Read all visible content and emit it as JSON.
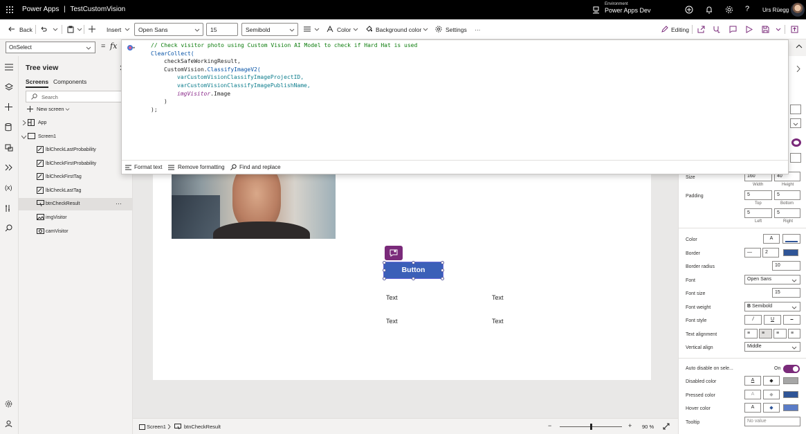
{
  "app": {
    "name": "Power Apps",
    "separator": "|",
    "project": "TestCustomVision"
  },
  "environment": {
    "label": "Environment",
    "name": "Power Apps Dev"
  },
  "user": {
    "name": "Urs Rüegg"
  },
  "toolbar": {
    "back": "Back",
    "insert": "Insert",
    "font": "Open Sans",
    "font_size": "15",
    "font_weight": "Semibold",
    "color": "Color",
    "background_color": "Background color",
    "settings": "Settings",
    "more": "···",
    "editing": "Editing"
  },
  "formula": {
    "property": "OnSelect",
    "fx": "fx",
    "equals": "=",
    "lines": [
      {
        "indent": 0,
        "parts": [
          {
            "t": "// Check visitor photo using Custom Vision AI Model to check if Hard Hat is used",
            "c": "c-com"
          }
        ]
      },
      {
        "indent": 0,
        "parts": [
          {
            "t": "ClearCollect(",
            "c": "c-fn"
          }
        ]
      },
      {
        "indent": 1,
        "parts": [
          {
            "t": "checkSafeWorkingResult,",
            "c": "c-id"
          }
        ]
      },
      {
        "indent": 1,
        "parts": [
          {
            "t": "CustomVision.",
            "c": "c-id"
          },
          {
            "t": "ClassifyImageV2(",
            "c": "c-fn"
          }
        ]
      },
      {
        "indent": 2,
        "parts": [
          {
            "t": "varCustomVisionClassifyImageProjectID,",
            "c": "c-var"
          }
        ]
      },
      {
        "indent": 2,
        "parts": [
          {
            "t": "varCustomVisionClassifyImagePublishName,",
            "c": "c-var"
          }
        ]
      },
      {
        "indent": 2,
        "parts": [
          {
            "t": "imgVisitor",
            "c": "c-ctl"
          },
          {
            "t": ".Image",
            "c": "c-id"
          }
        ]
      },
      {
        "indent": 1,
        "parts": [
          {
            "t": ")",
            "c": "c-id"
          }
        ]
      },
      {
        "indent": 0,
        "parts": [
          {
            "t": ");",
            "c": "c-id"
          }
        ]
      }
    ],
    "footer": {
      "format_text": "Format text",
      "remove_formatting": "Remove formatting",
      "find_replace": "Find and replace"
    }
  },
  "tree": {
    "title": "Tree view",
    "tabs": [
      "Screens",
      "Components"
    ],
    "search_placeholder": "Search",
    "new_screen": "New screen",
    "app": "App",
    "screen": "Screen1",
    "items": [
      "lblCheckLastProbability",
      "lblCheckFirstProbability",
      "lblCheckFirstTag",
      "lblCheckLastTag",
      "btnCheckResult",
      "imgVisitor",
      "camVisitor"
    ],
    "selected": "btnCheckResult",
    "item_more": "···"
  },
  "canvas": {
    "button_text": "Button",
    "labels": [
      "Text",
      "Text",
      "Text",
      "Text"
    ]
  },
  "status": {
    "screen": "Screen1",
    "control": "btnCheckResult",
    "zoom": "90",
    "zoom_unit": "%",
    "minus": "−",
    "plus": "+"
  },
  "props": {
    "size": {
      "label": "Size",
      "width": "160",
      "height": "40",
      "width_label": "Width",
      "height_label": "Height"
    },
    "padding": {
      "label": "Padding",
      "top": "5",
      "bottom": "5",
      "left": "5",
      "right": "5",
      "top_label": "Top",
      "bottom_label": "Bottom",
      "left_label": "Left",
      "right_label": "Right"
    },
    "color": "Color",
    "border": {
      "label": "Border",
      "width": "2"
    },
    "border_radius": {
      "label": "Border radius",
      "value": "10"
    },
    "font": {
      "label": "Font",
      "value": "Open Sans"
    },
    "font_size": {
      "label": "Font size",
      "value": "15"
    },
    "font_weight": {
      "label": "Font weight",
      "value": "Semibold"
    },
    "font_style": "Font style",
    "text_alignment": "Text alignment",
    "vertical_align": {
      "label": "Vertical align",
      "value": "Middle"
    },
    "auto_disable": {
      "label": "Auto disable on sele...",
      "value": "On"
    },
    "disabled_color": "Disabled color",
    "pressed_color": "Pressed color",
    "hover_color": "Hover color",
    "tooltip": {
      "label": "Tooltip",
      "placeholder": "No value"
    },
    "colors": {
      "accent": "#7a2a7a",
      "button": "#3b5fb8",
      "border": "#2f5597",
      "disabled": "#a6a6a6",
      "hover": "#5a7cc7"
    }
  }
}
